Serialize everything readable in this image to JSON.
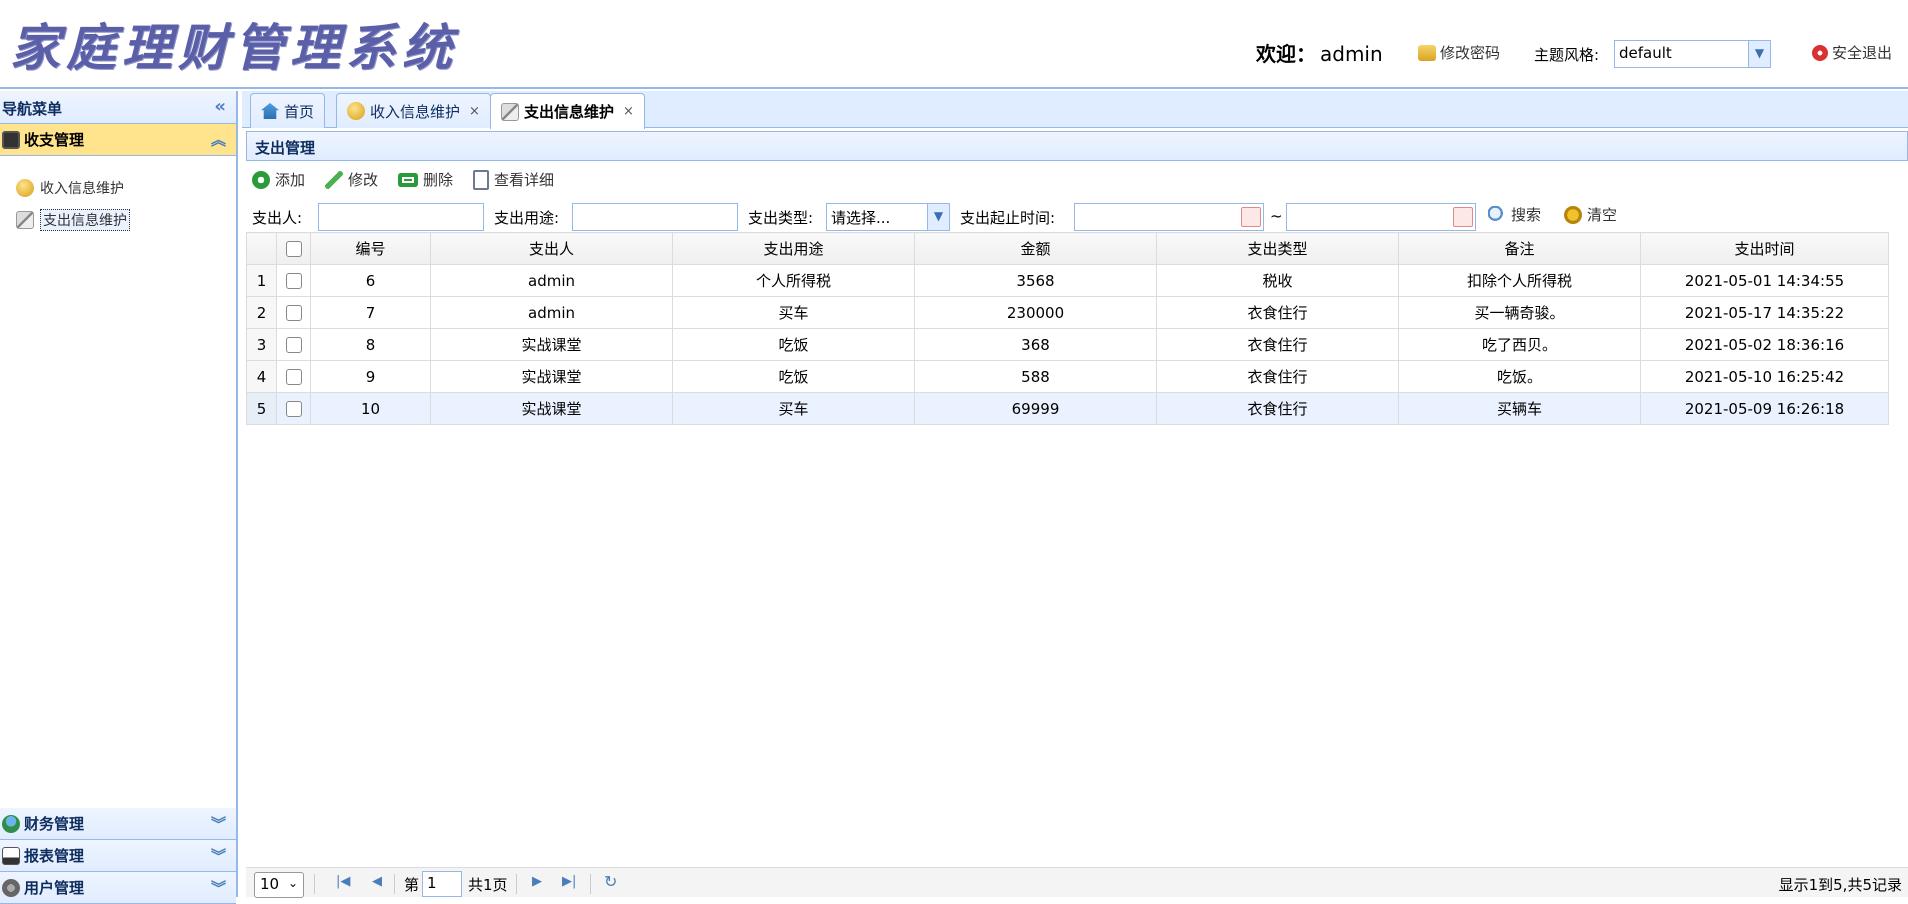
{
  "header": {
    "logo_text": "家庭理财管理系统",
    "welcome_label": "欢迎：",
    "welcome_user": "admin",
    "change_password": "修改密码",
    "theme_label": "主题风格:",
    "theme_value": "default",
    "logout": "安全退出"
  },
  "nav": {
    "title": "导航菜单",
    "panels": [
      {
        "label": "收支管理",
        "items": [
          "收入信息维护",
          "支出信息维护"
        ]
      },
      {
        "label": "财务管理"
      },
      {
        "label": "报表管理"
      },
      {
        "label": "用户管理"
      }
    ]
  },
  "tabs": [
    {
      "label": "首页"
    },
    {
      "label": "收入信息维护"
    },
    {
      "label": "支出信息维护"
    }
  ],
  "panel_title": "支出管理",
  "toolbar": {
    "add": "添加",
    "edit": "修改",
    "delete": "删除",
    "detail": "查看详细"
  },
  "search": {
    "payer_label": "支出人:",
    "purpose_label": "支出用途:",
    "type_label": "支出类型:",
    "type_value": "请选择...",
    "time_label": "支出起止时间:",
    "range_sep": "~",
    "search_btn": "搜索",
    "clear_btn": "清空"
  },
  "grid": {
    "columns": [
      "编号",
      "支出人",
      "支出用途",
      "金额",
      "支出类型",
      "备注",
      "支出时间"
    ],
    "rows": [
      {
        "rn": "1",
        "id": "6",
        "payer": "admin",
        "purpose": "个人所得税",
        "amount": "3568",
        "type": "税收",
        "note": "扣除个人所得税",
        "time": "2021-05-01 14:34:55"
      },
      {
        "rn": "2",
        "id": "7",
        "payer": "admin",
        "purpose": "买车",
        "amount": "230000",
        "type": "衣食住行",
        "note": "买一辆奇骏。",
        "time": "2021-05-17 14:35:22"
      },
      {
        "rn": "3",
        "id": "8",
        "payer": "实战课堂",
        "purpose": "吃饭",
        "amount": "368",
        "type": "衣食住行",
        "note": "吃了西贝。",
        "time": "2021-05-02 18:36:16"
      },
      {
        "rn": "4",
        "id": "9",
        "payer": "实战课堂",
        "purpose": "吃饭",
        "amount": "588",
        "type": "衣食住行",
        "note": "吃饭。",
        "time": "2021-05-10 16:25:42"
      },
      {
        "rn": "5",
        "id": "10",
        "payer": "实战课堂",
        "purpose": "买车",
        "amount": "69999",
        "type": "衣食住行",
        "note": "买辆车",
        "time": "2021-05-09 16:26:18"
      }
    ]
  },
  "pager": {
    "page_size": "10",
    "page_prefix": "第",
    "page_value": "1",
    "page_total": "共1页",
    "summary": "显示1到5,共5记录"
  },
  "colors": {
    "accent_border": "#95b8e7",
    "active_panel": "#ffe48d",
    "logo": "#5a5fa8"
  }
}
